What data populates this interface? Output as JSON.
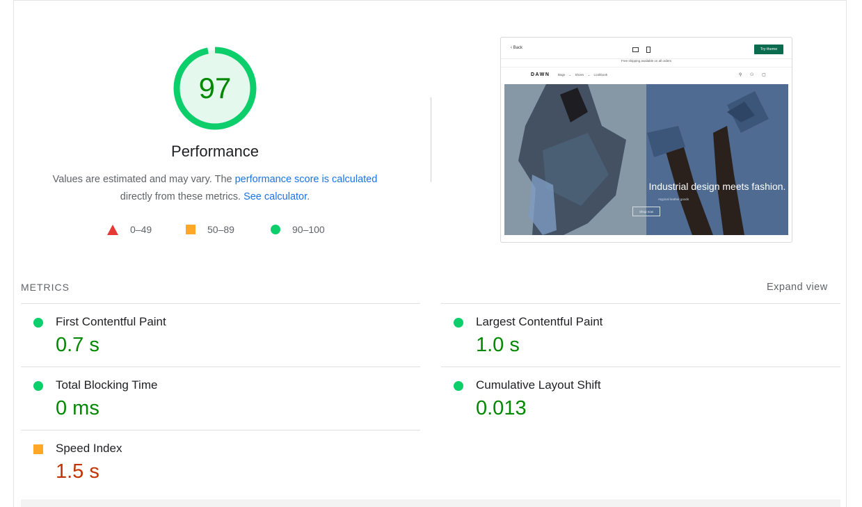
{
  "score": {
    "value": "97",
    "fraction": 0.97,
    "label": "Performance",
    "color": "#0cce6b"
  },
  "description": {
    "text_before": "Values are estimated and may vary. The ",
    "link1": "performance score is calculated",
    "text_middle": " directly from these metrics. ",
    "link2": "See calculator",
    "text_after": "."
  },
  "legend": [
    {
      "shape": "triangle-icon",
      "range": "0–49",
      "color": "#e53935"
    },
    {
      "shape": "square-icon",
      "range": "50–89",
      "color": "#ffa726"
    },
    {
      "shape": "circle-icon",
      "range": "90–100",
      "color": "#0cce6b"
    }
  ],
  "thumbnail": {
    "back": "‹ Back",
    "try_button": "Try theme",
    "announcement": "Free shipping available on all orders",
    "brand": "DAWN",
    "nav_links": "Bags ⌄ Shoes ⌄ Lookbook",
    "hero_title": "Industrial design meets fashion.",
    "hero_subtitle": "Atypical leather goods",
    "hero_button": "Shop now"
  },
  "metrics": {
    "title": "METRICS",
    "expand_label": "Expand view",
    "items": [
      {
        "name": "First Contentful Paint",
        "value": "0.7 s",
        "rating": "pass"
      },
      {
        "name": "Largest Contentful Paint",
        "value": "1.0 s",
        "rating": "pass"
      },
      {
        "name": "Total Blocking Time",
        "value": "0 ms",
        "rating": "pass"
      },
      {
        "name": "Cumulative Layout Shift",
        "value": "0.013",
        "rating": "pass"
      },
      {
        "name": "Speed Index",
        "value": "1.5 s",
        "rating": "average"
      }
    ]
  }
}
